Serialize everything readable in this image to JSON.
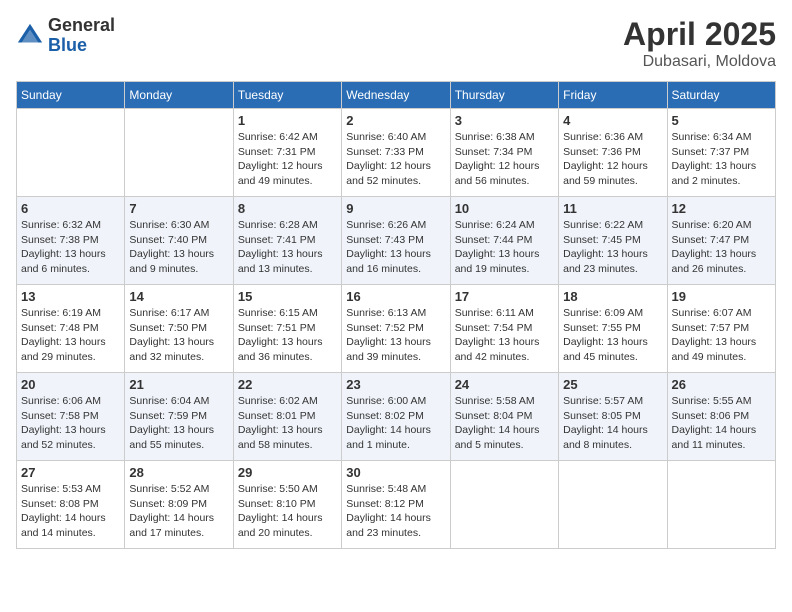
{
  "header": {
    "logo_line1": "General",
    "logo_line2": "Blue",
    "month_year": "April 2025",
    "location": "Dubasari, Moldova"
  },
  "weekdays": [
    "Sunday",
    "Monday",
    "Tuesday",
    "Wednesday",
    "Thursday",
    "Friday",
    "Saturday"
  ],
  "weeks": [
    [
      {
        "day": "",
        "info": ""
      },
      {
        "day": "",
        "info": ""
      },
      {
        "day": "1",
        "info": "Sunrise: 6:42 AM\nSunset: 7:31 PM\nDaylight: 12 hours and 49 minutes."
      },
      {
        "day": "2",
        "info": "Sunrise: 6:40 AM\nSunset: 7:33 PM\nDaylight: 12 hours and 52 minutes."
      },
      {
        "day": "3",
        "info": "Sunrise: 6:38 AM\nSunset: 7:34 PM\nDaylight: 12 hours and 56 minutes."
      },
      {
        "day": "4",
        "info": "Sunrise: 6:36 AM\nSunset: 7:36 PM\nDaylight: 12 hours and 59 minutes."
      },
      {
        "day": "5",
        "info": "Sunrise: 6:34 AM\nSunset: 7:37 PM\nDaylight: 13 hours and 2 minutes."
      }
    ],
    [
      {
        "day": "6",
        "info": "Sunrise: 6:32 AM\nSunset: 7:38 PM\nDaylight: 13 hours and 6 minutes."
      },
      {
        "day": "7",
        "info": "Sunrise: 6:30 AM\nSunset: 7:40 PM\nDaylight: 13 hours and 9 minutes."
      },
      {
        "day": "8",
        "info": "Sunrise: 6:28 AM\nSunset: 7:41 PM\nDaylight: 13 hours and 13 minutes."
      },
      {
        "day": "9",
        "info": "Sunrise: 6:26 AM\nSunset: 7:43 PM\nDaylight: 13 hours and 16 minutes."
      },
      {
        "day": "10",
        "info": "Sunrise: 6:24 AM\nSunset: 7:44 PM\nDaylight: 13 hours and 19 minutes."
      },
      {
        "day": "11",
        "info": "Sunrise: 6:22 AM\nSunset: 7:45 PM\nDaylight: 13 hours and 23 minutes."
      },
      {
        "day": "12",
        "info": "Sunrise: 6:20 AM\nSunset: 7:47 PM\nDaylight: 13 hours and 26 minutes."
      }
    ],
    [
      {
        "day": "13",
        "info": "Sunrise: 6:19 AM\nSunset: 7:48 PM\nDaylight: 13 hours and 29 minutes."
      },
      {
        "day": "14",
        "info": "Sunrise: 6:17 AM\nSunset: 7:50 PM\nDaylight: 13 hours and 32 minutes."
      },
      {
        "day": "15",
        "info": "Sunrise: 6:15 AM\nSunset: 7:51 PM\nDaylight: 13 hours and 36 minutes."
      },
      {
        "day": "16",
        "info": "Sunrise: 6:13 AM\nSunset: 7:52 PM\nDaylight: 13 hours and 39 minutes."
      },
      {
        "day": "17",
        "info": "Sunrise: 6:11 AM\nSunset: 7:54 PM\nDaylight: 13 hours and 42 minutes."
      },
      {
        "day": "18",
        "info": "Sunrise: 6:09 AM\nSunset: 7:55 PM\nDaylight: 13 hours and 45 minutes."
      },
      {
        "day": "19",
        "info": "Sunrise: 6:07 AM\nSunset: 7:57 PM\nDaylight: 13 hours and 49 minutes."
      }
    ],
    [
      {
        "day": "20",
        "info": "Sunrise: 6:06 AM\nSunset: 7:58 PM\nDaylight: 13 hours and 52 minutes."
      },
      {
        "day": "21",
        "info": "Sunrise: 6:04 AM\nSunset: 7:59 PM\nDaylight: 13 hours and 55 minutes."
      },
      {
        "day": "22",
        "info": "Sunrise: 6:02 AM\nSunset: 8:01 PM\nDaylight: 13 hours and 58 minutes."
      },
      {
        "day": "23",
        "info": "Sunrise: 6:00 AM\nSunset: 8:02 PM\nDaylight: 14 hours and 1 minute."
      },
      {
        "day": "24",
        "info": "Sunrise: 5:58 AM\nSunset: 8:04 PM\nDaylight: 14 hours and 5 minutes."
      },
      {
        "day": "25",
        "info": "Sunrise: 5:57 AM\nSunset: 8:05 PM\nDaylight: 14 hours and 8 minutes."
      },
      {
        "day": "26",
        "info": "Sunrise: 5:55 AM\nSunset: 8:06 PM\nDaylight: 14 hours and 11 minutes."
      }
    ],
    [
      {
        "day": "27",
        "info": "Sunrise: 5:53 AM\nSunset: 8:08 PM\nDaylight: 14 hours and 14 minutes."
      },
      {
        "day": "28",
        "info": "Sunrise: 5:52 AM\nSunset: 8:09 PM\nDaylight: 14 hours and 17 minutes."
      },
      {
        "day": "29",
        "info": "Sunrise: 5:50 AM\nSunset: 8:10 PM\nDaylight: 14 hours and 20 minutes."
      },
      {
        "day": "30",
        "info": "Sunrise: 5:48 AM\nSunset: 8:12 PM\nDaylight: 14 hours and 23 minutes."
      },
      {
        "day": "",
        "info": ""
      },
      {
        "day": "",
        "info": ""
      },
      {
        "day": "",
        "info": ""
      }
    ]
  ]
}
